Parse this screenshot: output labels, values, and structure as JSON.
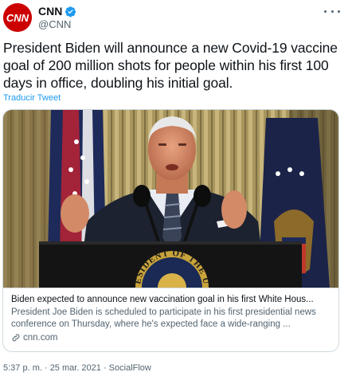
{
  "account": {
    "display_name": "CNN",
    "handle": "@CNN",
    "avatar_text": "CNN"
  },
  "tweet": {
    "text": "President Biden will announce a new Covid-19 vaccine goal of 200 million shots for people within his first 100 days in office, doubling his initial goal.",
    "translate_link": "Traducir Tweet"
  },
  "card": {
    "title": "Biden expected to announce new vaccination goal in his first White Hous...",
    "description": "President Joe Biden is scheduled to participate in his first presidential news conference on Thursday, where he's expected face a wide-ranging ...",
    "domain": "cnn.com",
    "seal_text": "ESIDENT OF THE UN"
  },
  "meta": {
    "timestamp": "5:37 p. m. · 25 mar. 2021 · SocialFlow"
  },
  "icons": {
    "verified": "verified-badge-icon",
    "more": "more-dots-icon",
    "link": "link-icon"
  },
  "colors": {
    "brand_red": "#cc0000",
    "link_blue": "#1d9bf0",
    "secondary_text": "#536471"
  }
}
